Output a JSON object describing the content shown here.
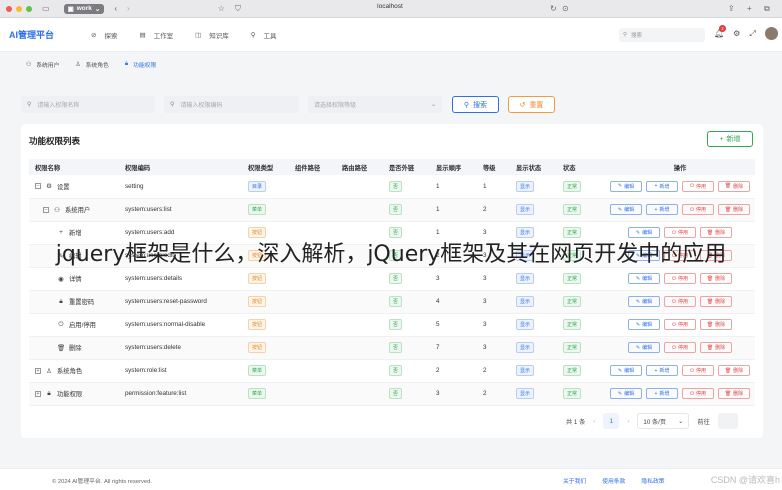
{
  "browser": {
    "tab_label": "work",
    "url": "localhost"
  },
  "app": {
    "brand": "AI管理平台",
    "nav": [
      {
        "icon": "compass-icon",
        "glyph": "⊘",
        "label": "探索"
      },
      {
        "icon": "grid-icon",
        "glyph": "▤",
        "label": "工作室"
      },
      {
        "icon": "book-icon",
        "glyph": "◫",
        "label": "知识库"
      },
      {
        "icon": "tool-icon",
        "glyph": "⚲",
        "label": "工具"
      }
    ],
    "search_placeholder": "搜索",
    "notification_count": "2"
  },
  "breadcrumb": [
    {
      "glyph": "⚇",
      "label": "系统用户"
    },
    {
      "glyph": "♙",
      "label": "系统角色"
    },
    {
      "glyph": "🔒",
      "label": "功能权限"
    }
  ],
  "filters": {
    "name_placeholder": "请输入权限名称",
    "code_placeholder": "请输入权限编码",
    "level_placeholder": "请选择权限等级",
    "search_label": "搜索",
    "reset_label": "重置"
  },
  "card": {
    "title": "功能权限列表",
    "add_label": "新增"
  },
  "table": {
    "headers": [
      "权限名称",
      "权限编码",
      "权限类型",
      "组件路径",
      "路由路径",
      "是否外链",
      "显示顺序",
      "等级",
      "显示状态",
      "状态",
      "操作"
    ],
    "rows": [
      {
        "name": "设置",
        "code": "setting",
        "type": "目录",
        "ext": "否",
        "order": "1",
        "level": "1",
        "show": "显示",
        "status": "正常"
      },
      {
        "name": "系统用户",
        "code": "system:users:list",
        "type": "菜单",
        "ext": "否",
        "order": "1",
        "level": "2",
        "show": "显示",
        "status": "正常"
      },
      {
        "name": "新增",
        "code": "system:users:add",
        "type": "按钮",
        "ext": "否",
        "order": "1",
        "level": "3",
        "show": "显示",
        "status": "正常"
      },
      {
        "name": "编辑",
        "code": "system:users:edit",
        "type": "按钮",
        "ext": "否",
        "order": "2",
        "level": "3",
        "show": "显示",
        "status": "正常"
      },
      {
        "name": "详情",
        "code": "system:users:details",
        "type": "按钮",
        "ext": "否",
        "order": "3",
        "level": "3",
        "show": "显示",
        "status": "正常"
      },
      {
        "name": "重置密码",
        "code": "system:users:reset-password",
        "type": "按钮",
        "ext": "否",
        "order": "4",
        "level": "3",
        "show": "显示",
        "status": "正常"
      },
      {
        "name": "启用/停用",
        "code": "system:users:normal-disable",
        "type": "按钮",
        "ext": "否",
        "order": "5",
        "level": "3",
        "show": "显示",
        "status": "正常"
      },
      {
        "name": "删除",
        "code": "system:users:delete",
        "type": "按钮",
        "ext": "否",
        "order": "7",
        "level": "3",
        "show": "显示",
        "status": "正常"
      },
      {
        "name": "系统角色",
        "code": "system:role:list",
        "type": "菜单",
        "ext": "否",
        "order": "2",
        "level": "2",
        "show": "显示",
        "status": "正常"
      },
      {
        "name": "功能权限",
        "code": "permission:feature:list",
        "type": "菜单",
        "ext": "否",
        "order": "3",
        "level": "2",
        "show": "显示",
        "status": "正常"
      }
    ],
    "ops": {
      "edit": "编辑",
      "add": "新增",
      "disable": "停用",
      "delete": "删除"
    }
  },
  "pagination": {
    "total": "共 1 条",
    "page": "1",
    "page_size": "10 条/页",
    "jump_label": "前往"
  },
  "footer": {
    "copyright": "© 2024 AI管理平台. All rights reserved.",
    "links": [
      "关于我们",
      "使用条款",
      "隐私政策"
    ]
  },
  "overlay_text": "jquery框架是什么，深入解析，jQuery框架及其在网页开发中的应用",
  "watermark": "CSDN @请欢喜h"
}
